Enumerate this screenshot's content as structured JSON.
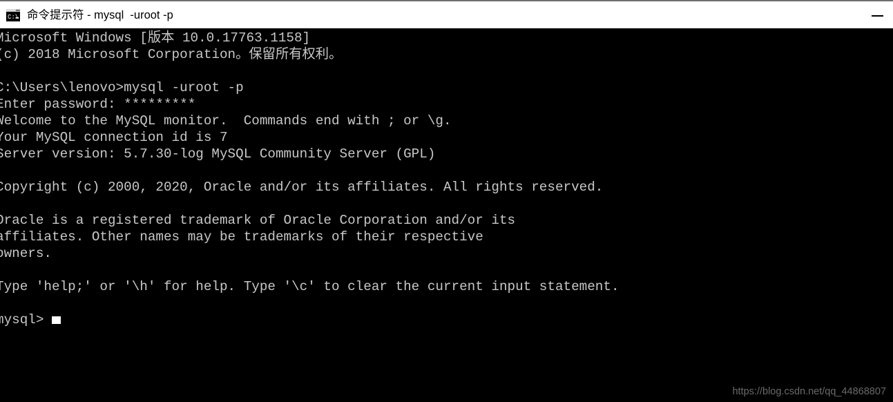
{
  "window": {
    "title": "命令提示符 - mysql  -uroot -p",
    "icon_name": "command-prompt-icon",
    "controls": {
      "minimize_label": "最小化",
      "minimize_icon": "minimize-icon"
    },
    "titlebar_background": "#ffffff",
    "titlebar_text_color": "#000000"
  },
  "console": {
    "background_color": "#000000",
    "text_color": "#c8c8c8",
    "cursor_color": "#ffffff",
    "font_size_px": 19,
    "line_height_px": 24,
    "lines": [
      "Microsoft Windows [版本 10.0.17763.1158]",
      "(c) 2018 Microsoft Corporation。保留所有权利。",
      "",
      "C:\\Users\\lenovo>mysql -uroot -p",
      "Enter password: *********",
      "Welcome to the MySQL monitor.  Commands end with ; or \\g.",
      "Your MySQL connection id is 7",
      "Server version: 5.7.30-log MySQL Community Server (GPL)",
      "",
      "Copyright (c) 2000, 2020, Oracle and/or its affiliates. All rights reserved.",
      "",
      "Oracle is a registered trademark of Oracle Corporation and/or its",
      "affiliates. Other names may be trademarks of their respective",
      "owners.",
      "",
      "Type 'help;' or '\\h' for help. Type '\\c' to clear the current input statement.",
      ""
    ],
    "prompt": "mysql> ",
    "prompt_cursor": "block"
  },
  "watermark": {
    "text": "https://blog.csdn.net/qq_44868807",
    "color": "#6a6a6a"
  }
}
